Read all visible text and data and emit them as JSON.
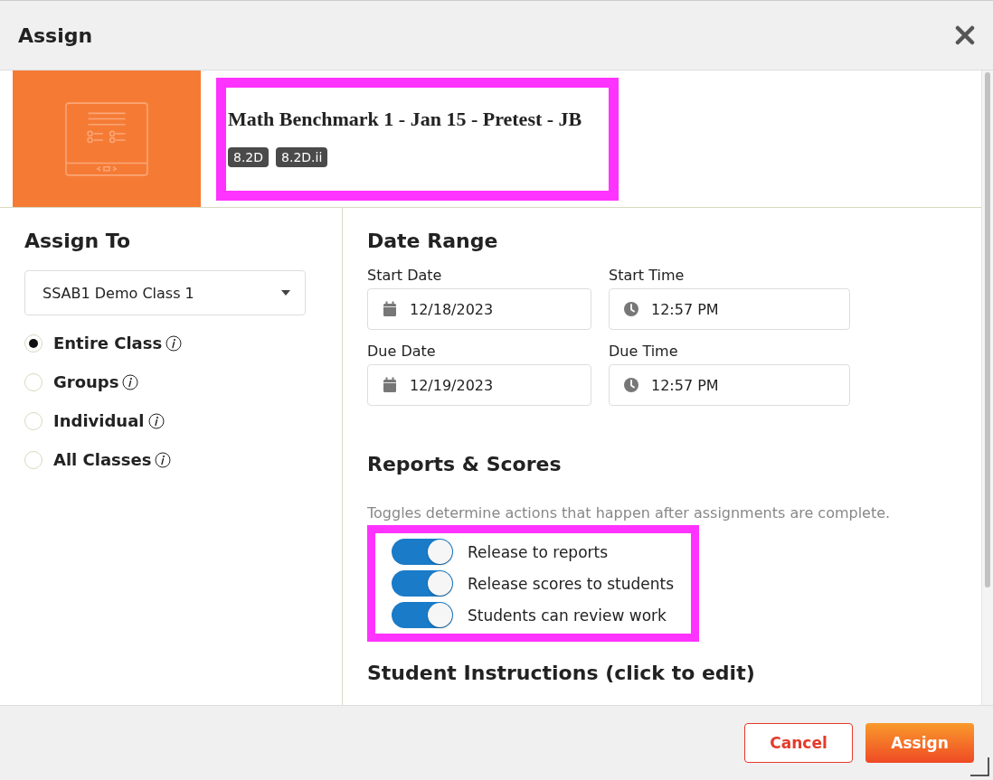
{
  "window": {
    "title": "Assign"
  },
  "assignment": {
    "title": "Math Benchmark 1 - Jan 15 - Pretest - JB",
    "standards": [
      "8.2D",
      "8.2D.ii"
    ]
  },
  "assign_to": {
    "heading": "Assign To",
    "class_select": {
      "value": "SSAB1 Demo Class 1"
    },
    "options": [
      {
        "label": "Entire Class",
        "selected": true
      },
      {
        "label": "Groups",
        "selected": false
      },
      {
        "label": "Individual",
        "selected": false
      },
      {
        "label": "All Classes",
        "selected": false
      }
    ]
  },
  "date_range": {
    "heading": "Date Range",
    "fields": [
      {
        "label": "Start Date",
        "value": "12/18/2023",
        "kind": "date"
      },
      {
        "label": "Start Time",
        "value": "12:57 PM",
        "kind": "time"
      },
      {
        "label": "Due Date",
        "value": "12/19/2023",
        "kind": "date"
      },
      {
        "label": "Due Time",
        "value": "12:57 PM",
        "kind": "time"
      }
    ]
  },
  "reports_scores": {
    "heading": "Reports & Scores",
    "hint": "Toggles determine actions that happen after assignments are complete.",
    "toggles": [
      {
        "label": "Release to reports",
        "on": true
      },
      {
        "label": "Release scores to students",
        "on": true
      },
      {
        "label": "Students can review work",
        "on": true
      }
    ]
  },
  "student_instructions": {
    "heading": "Student Instructions (click to edit)"
  },
  "buttons": [
    {
      "label": "Cancel",
      "kind": "secondary"
    },
    {
      "label": "Assign",
      "kind": "primary"
    }
  ]
}
